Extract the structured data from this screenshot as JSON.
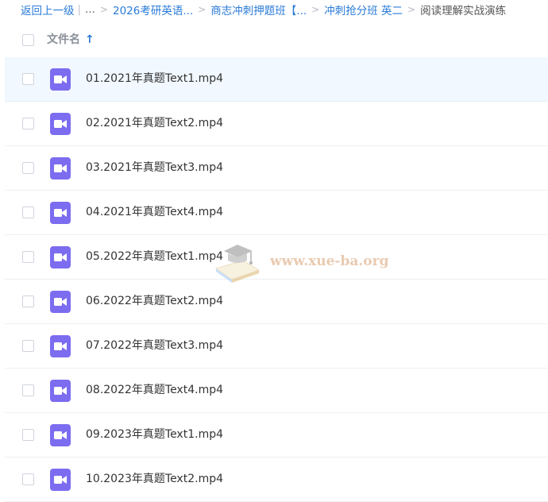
{
  "breadcrumb": {
    "back": "返回上一级",
    "ellipsis": "...",
    "items": [
      "2026考研英语...",
      "商志冲刺押题班【...",
      "冲刺抢分班 英二"
    ],
    "current": "阅读理解实战演练"
  },
  "header": {
    "column_name": "文件名",
    "sort_icon": "arrow-up-icon"
  },
  "files": [
    {
      "name": "01.2021年真题Text1.mp4",
      "type": "video",
      "selected": true
    },
    {
      "name": "02.2021年真题Text2.mp4",
      "type": "video"
    },
    {
      "name": "03.2021年真题Text3.mp4",
      "type": "video"
    },
    {
      "name": "04.2021年真题Text4.mp4",
      "type": "video"
    },
    {
      "name": "05.2022年真题Text1.mp4",
      "type": "video"
    },
    {
      "name": "06.2022年真题Text2.mp4",
      "type": "video"
    },
    {
      "name": "07.2022年真题Text3.mp4",
      "type": "video"
    },
    {
      "name": "08.2022年真题Text4.mp4",
      "type": "video"
    },
    {
      "name": "09.2023年真题Text1.mp4",
      "type": "video"
    },
    {
      "name": "10.2023年真题Text2.mp4",
      "type": "video"
    }
  ],
  "watermark": {
    "text": "www.xue-ba.org"
  },
  "colors": {
    "link": "#2a7bd8",
    "video_icon": "#7c6cf0",
    "selected_row": "#f1f8ff"
  }
}
